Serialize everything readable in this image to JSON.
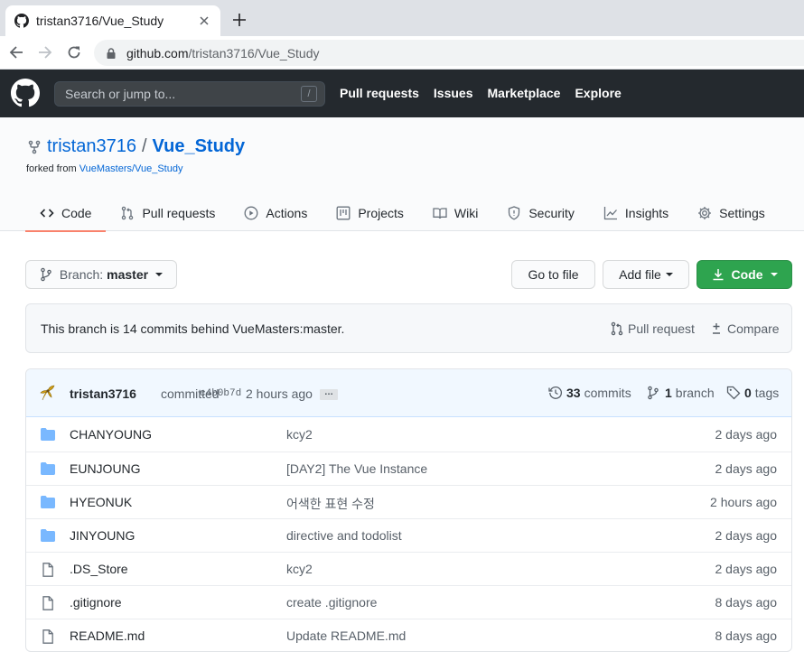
{
  "browser": {
    "tab_title": "tristan3716/Vue_Study",
    "url_host": "github.com",
    "url_path": "/tristan3716/Vue_Study"
  },
  "header": {
    "search_placeholder": "Search or jump to...",
    "search_shortcut": "/",
    "nav": [
      "Pull requests",
      "Issues",
      "Marketplace",
      "Explore"
    ]
  },
  "repo": {
    "owner": "tristan3716",
    "separator": "/",
    "name": "Vue_Study",
    "forked_from_label": "forked from",
    "forked_from_repo": "VueMasters/Vue_Study"
  },
  "repo_nav": [
    {
      "label": "Code",
      "icon": "code-icon"
    },
    {
      "label": "Pull requests",
      "icon": "pull-request-icon"
    },
    {
      "label": "Actions",
      "icon": "play-icon"
    },
    {
      "label": "Projects",
      "icon": "project-icon"
    },
    {
      "label": "Wiki",
      "icon": "book-icon"
    },
    {
      "label": "Security",
      "icon": "shield-icon"
    },
    {
      "label": "Insights",
      "icon": "graph-icon"
    },
    {
      "label": "Settings",
      "icon": "gear-icon"
    }
  ],
  "toolbar": {
    "branch_label": "Branch:",
    "branch_name": "master",
    "go_to_file": "Go to file",
    "add_file": "Add file",
    "code": "Code"
  },
  "behind": {
    "text": "This branch is 14 commits behind VueMasters:master.",
    "pull_request": "Pull request",
    "compare": "Compare"
  },
  "commit": {
    "author": "tristan3716",
    "verb": "committed",
    "sha": "c4b0b7d",
    "time": "2 hours ago",
    "ellipsis": "…",
    "commits_count": "33",
    "commits_label": "commits",
    "branch_count": "1",
    "branch_label": "branch",
    "tags_count": "0",
    "tags_label": "tags"
  },
  "files": [
    {
      "type": "dir",
      "name": "CHANYOUNG",
      "message": "kcy2",
      "age": "2 days ago"
    },
    {
      "type": "dir",
      "name": "EUNJOUNG",
      "message": "[DAY2] The Vue Instance",
      "age": "2 days ago"
    },
    {
      "type": "dir",
      "name": "HYEONUK",
      "message": "어색한 표현 수정",
      "age": "2 hours ago"
    },
    {
      "type": "dir",
      "name": "JINYOUNG",
      "message": "directive and todolist",
      "age": "2 days ago"
    },
    {
      "type": "file",
      "name": ".DS_Store",
      "message": "kcy2",
      "age": "2 days ago"
    },
    {
      "type": "file",
      "name": ".gitignore",
      "message": "create .gitignore",
      "age": "8 days ago"
    },
    {
      "type": "file",
      "name": "README.md",
      "message": "Update README.md",
      "age": "8 days ago"
    }
  ],
  "colors": {
    "header_bg": "#24292e",
    "link": "#0366d6",
    "green_button": "#2ea44f",
    "folder": "#79b8ff",
    "selected_tab_underline": "#f9826c"
  }
}
